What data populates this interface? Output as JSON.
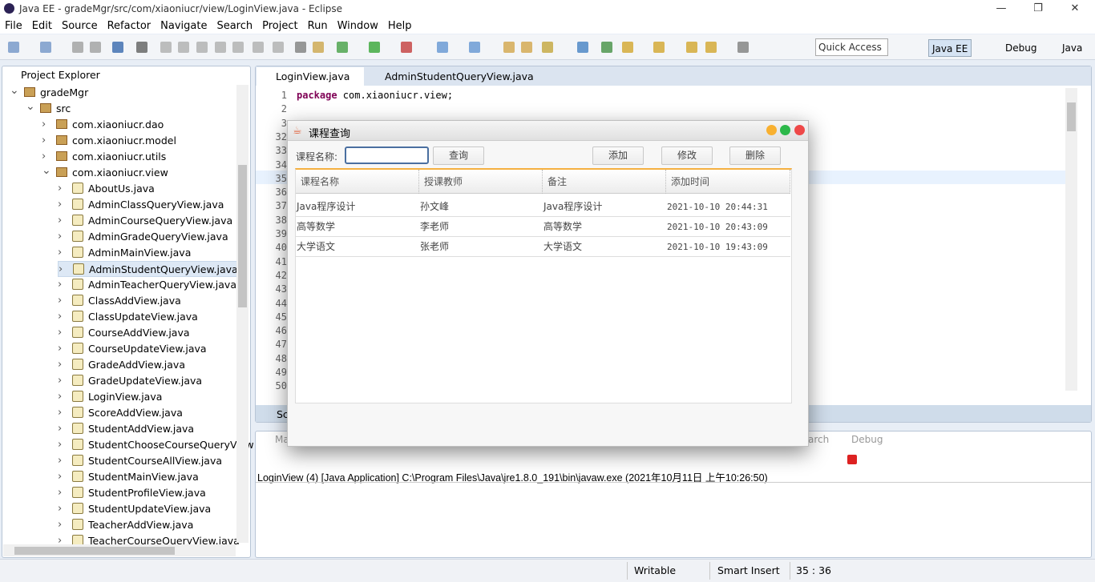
{
  "window": {
    "title": "Java EE - gradeMgr/src/com/xiaoniucr/view/LoginView.java - Eclipse",
    "min": "—",
    "max": "❐",
    "close": "✕"
  },
  "menu": [
    "File",
    "Edit",
    "Source",
    "Refactor",
    "Navigate",
    "Search",
    "Project",
    "Run",
    "Window",
    "Help"
  ],
  "toolbar": {
    "quick_access": "Quick Access",
    "perspectives": [
      "Java EE",
      "Debug",
      "Java"
    ]
  },
  "project_explorer": {
    "title": "Project Explorer",
    "tree": [
      {
        "label": "gradeMgr",
        "level": 0,
        "type": "project",
        "open": true
      },
      {
        "label": "src",
        "level": 1,
        "type": "src",
        "open": true
      },
      {
        "label": "com.xiaoniucr.dao",
        "level": 2,
        "type": "pkg"
      },
      {
        "label": "com.xiaoniucr.model",
        "level": 2,
        "type": "pkg"
      },
      {
        "label": "com.xiaoniucr.utils",
        "level": 2,
        "type": "pkg"
      },
      {
        "label": "com.xiaoniucr.view",
        "level": 2,
        "type": "pkg",
        "open": true
      },
      {
        "label": "AboutUs.java",
        "level": 3,
        "type": "file"
      },
      {
        "label": "AdminClassQueryView.java",
        "level": 3,
        "type": "file"
      },
      {
        "label": "AdminCourseQueryView.java",
        "level": 3,
        "type": "file"
      },
      {
        "label": "AdminGradeQueryView.java",
        "level": 3,
        "type": "file"
      },
      {
        "label": "AdminMainView.java",
        "level": 3,
        "type": "file"
      },
      {
        "label": "AdminStudentQueryView.java",
        "level": 3,
        "type": "file",
        "selected": true
      },
      {
        "label": "AdminTeacherQueryView.java",
        "level": 3,
        "type": "file"
      },
      {
        "label": "ClassAddView.java",
        "level": 3,
        "type": "file"
      },
      {
        "label": "ClassUpdateView.java",
        "level": 3,
        "type": "file"
      },
      {
        "label": "CourseAddView.java",
        "level": 3,
        "type": "file"
      },
      {
        "label": "CourseUpdateView.java",
        "level": 3,
        "type": "file"
      },
      {
        "label": "GradeAddView.java",
        "level": 3,
        "type": "file"
      },
      {
        "label": "GradeUpdateView.java",
        "level": 3,
        "type": "file"
      },
      {
        "label": "LoginView.java",
        "level": 3,
        "type": "file"
      },
      {
        "label": "ScoreAddView.java",
        "level": 3,
        "type": "file"
      },
      {
        "label": "StudentAddView.java",
        "level": 3,
        "type": "file"
      },
      {
        "label": "StudentChooseCourseQueryView",
        "level": 3,
        "type": "file"
      },
      {
        "label": "StudentCourseAllView.java",
        "level": 3,
        "type": "file"
      },
      {
        "label": "StudentMainView.java",
        "level": 3,
        "type": "file"
      },
      {
        "label": "StudentProfileView.java",
        "level": 3,
        "type": "file"
      },
      {
        "label": "StudentUpdateView.java",
        "level": 3,
        "type": "file"
      },
      {
        "label": "TeacherAddView.java",
        "level": 3,
        "type": "file"
      },
      {
        "label": "TeacherCourseQueryView.java",
        "level": 3,
        "type": "file"
      }
    ]
  },
  "editor": {
    "tabs": [
      "LoginView.java",
      "AdminStudentQueryView.java"
    ],
    "line_numbers": [
      "1",
      "2",
      "3",
      "32",
      "33",
      "34",
      "35",
      "36",
      "37",
      "38",
      "39",
      "40",
      "41",
      "42",
      "43",
      "44",
      "45",
      "46",
      "47",
      "48",
      "49",
      "50"
    ],
    "code_line1_keyword": "package",
    "code_line1_rest": " com.xiaoniucr.view;"
  },
  "console": {
    "tabs_partial": [
      "Ma",
      "arch",
      "Debug"
    ],
    "bottom_tab_partial": "Sc",
    "launch": "LoginView (4) [Java Application] C:\\Program Files\\Java\\jre1.8.0_191\\bin\\javaw.exe (2021年10月11日 上午10:26:50)"
  },
  "statusbar": {
    "writable": "Writable",
    "insert": "Smart Insert",
    "position": "35 : 36"
  },
  "dialog": {
    "title": "课程查询",
    "search_label": "课程名称:",
    "search_value": "",
    "buttons": {
      "query": "查询",
      "add": "添加",
      "edit": "修改",
      "delete": "删除"
    },
    "columns": [
      "课程名称",
      "授课教师",
      "备注",
      "添加时间"
    ],
    "rows": [
      [
        "Java程序设计",
        "孙文峰",
        "Java程序设计",
        "2021-10-10 20:44:31"
      ],
      [
        "高等数学",
        "李老师",
        "高等数学",
        "2021-10-10 20:43:09"
      ],
      [
        "大学语文",
        "张老师",
        "大学语文",
        "2021-10-10 19:43:09"
      ]
    ],
    "colors": {
      "accent": "#f5b041",
      "min": "#f8b030",
      "max": "#2cb84a",
      "close": "#ee4848"
    }
  }
}
